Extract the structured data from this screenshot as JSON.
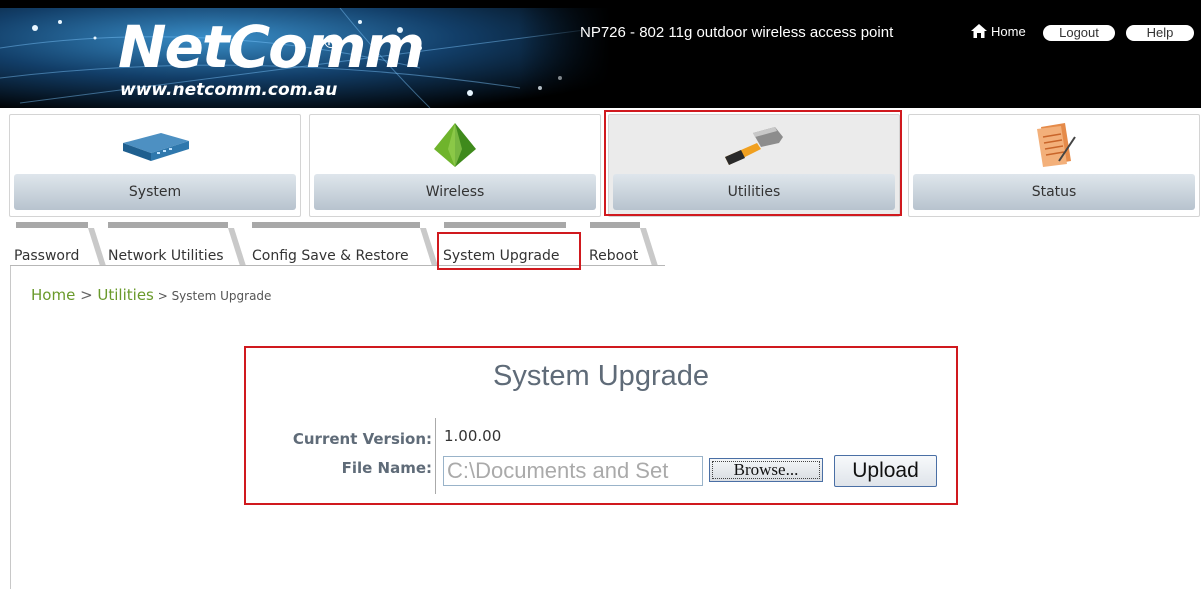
{
  "header": {
    "logo": "NetComm",
    "logo_reg": "®",
    "logo_url": "www.netcomm.com.au",
    "device_title": "NP726 - 802 11g outdoor wireless access point",
    "home_label": "Home",
    "logout_label": "Logout",
    "help_label": "Help"
  },
  "nav": {
    "items": [
      {
        "label": "System",
        "icon": "router-icon"
      },
      {
        "label": "Wireless",
        "icon": "pyramid-icon"
      },
      {
        "label": "Utilities",
        "icon": "hammer-icon"
      },
      {
        "label": "Status",
        "icon": "document-icon"
      }
    ],
    "active": "Utilities"
  },
  "tabs": {
    "items": [
      "Password",
      "Network Utilities",
      "Config Save & Restore",
      "System Upgrade",
      "Reboot"
    ],
    "active": "System Upgrade"
  },
  "breadcrumb": {
    "home": "Home",
    "sep1": " > ",
    "section": "Utilities",
    "sep2": " > ",
    "current": "System Upgrade"
  },
  "form": {
    "title": "System Upgrade",
    "current_version_label": "Current Version:",
    "current_version_value": "1.00.00",
    "file_name_label": "File Name:",
    "file_name_value": "C:\\Documents and Set",
    "browse_label": "Browse...",
    "upload_label": "Upload"
  },
  "colors": {
    "highlight": "#d0191e",
    "link_green": "#6a9a2b",
    "label_slate": "#5f6b78"
  }
}
